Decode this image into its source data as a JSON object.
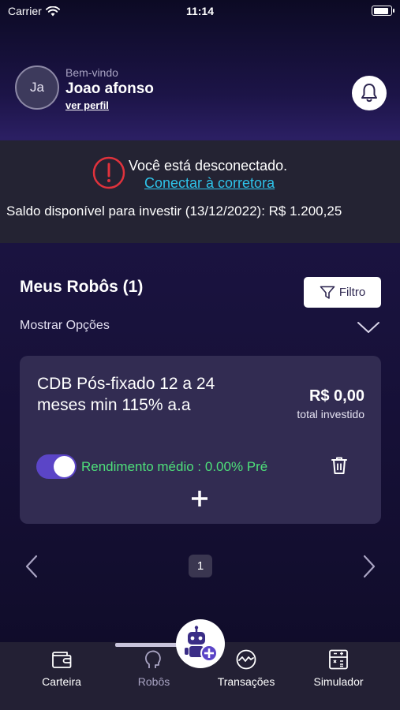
{
  "status_bar": {
    "carrier": "Carrier",
    "time": "11:14",
    "battery_level": 0.9
  },
  "header": {
    "avatar_initials": "Ja",
    "welcome": "Bem-vindo",
    "username": "Joao afonso",
    "profile_link": "ver perfil"
  },
  "banner": {
    "disconnected_text": "Você está desconectado.",
    "connect_link": "Conectar à corretora",
    "balance_text": "Saldo disponível para investir (13/12/2022): R$ 1.200,25"
  },
  "robots": {
    "section_title": "Meus Robôs (1)",
    "filter_label": "Filtro",
    "options_label": "Mostrar Opções",
    "card": {
      "title": "CDB Pós-fixado 12 a 24 meses min 115% a.a",
      "amount": "R$ 0,00",
      "amount_label": "total investido",
      "yield_text": "Rendimento médio : 0.00% Pré",
      "toggle_on": true
    }
  },
  "pagination": {
    "current_page": "1"
  },
  "tabbar": {
    "tabs": [
      {
        "label": "Carteira",
        "icon": "wallet-icon"
      },
      {
        "label": "Robôs",
        "icon": "robot-head-icon"
      },
      {
        "label": "Transações",
        "icon": "transactions-icon"
      },
      {
        "label": "Simulador",
        "icon": "calculator-icon"
      }
    ],
    "fab_icon": "add-robot-icon"
  },
  "colors": {
    "accent_link": "#2ec4ea",
    "yield_green": "#4ee07a",
    "toggle_purple": "#5b45c7",
    "warning_red": "#e0323c"
  }
}
